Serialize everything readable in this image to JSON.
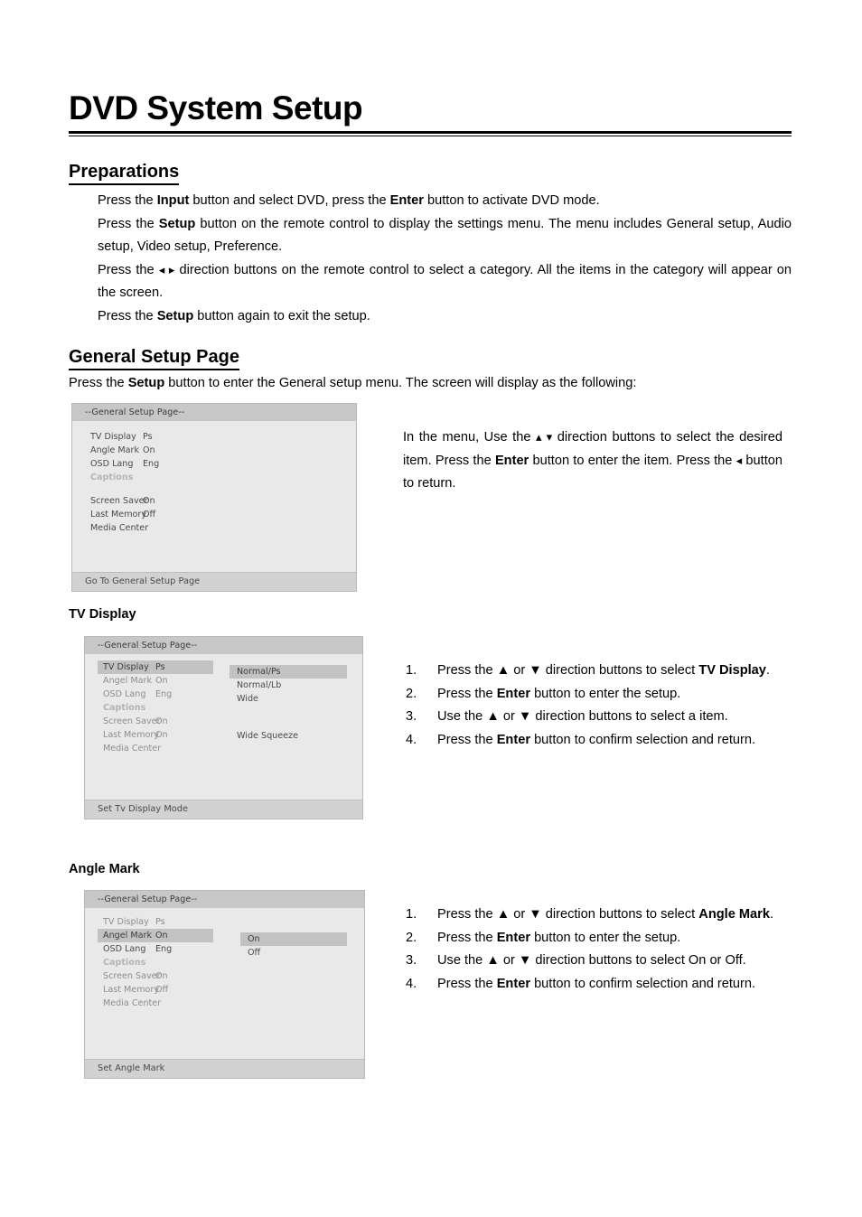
{
  "document": {
    "title": "DVD System Setup"
  },
  "preparations": {
    "heading": "Preparations",
    "lines": [
      " Press the Input button and select DVD, press the Enter button to activate DVD mode.",
      "Press the Setup button on the remote control to display the settings menu. The menu includes General setup, Audio setup, Video setup, Preference.",
      "Press the ◂ ▸ direction buttons on the remote control to select a category. All the items in the category will appear on the screen.",
      "Press the Setup button again to exit the setup."
    ],
    "line1_prefix": " Press the ",
    "line1_b1": "Input",
    "line1_mid": " button and select DVD, press the ",
    "line1_b2": "Enter",
    "line1_suffix": " button to activate DVD mode.",
    "line2_prefix": "Press the ",
    "line2_b1": "Setup",
    "line2_suffix": " button on the remote control to display the settings menu. The menu includes General setup, Audio setup, Video setup, Preference.",
    "line3_prefix": "Press the ",
    "line3_arrows": "◂ ▸",
    "line3_suffix": " direction buttons on the remote control to select a category. All the items in the category will appear on the screen.",
    "line4_prefix": "Press the ",
    "line4_b1": "Setup",
    "line4_suffix": " button again to exit the setup."
  },
  "general_setup": {
    "heading": "General Setup Page",
    "intro_prefix": "Press the ",
    "intro_bold": "Setup",
    "intro_suffix": " button to enter the General setup menu. The screen will display as the following:",
    "side_note_1": "In the menu, Use the ",
    "side_note_arrows": "▴ ▾",
    "side_note_2": " direction buttons to select the desired item. Press the ",
    "side_note_bold": "Enter",
    "side_note_3": " button to enter the item. Press the ",
    "side_note_arrow_left": "◂",
    "side_note_4": " button to return."
  },
  "osd_general": {
    "title": "--General Setup Page--",
    "footer": "Go To General Setup Page",
    "rows": [
      {
        "label": "TV Display",
        "value": "Ps"
      },
      {
        "label": "Angle Mark",
        "value": "On"
      },
      {
        "label": "OSD Lang",
        "value": "Eng"
      },
      {
        "label": "Captions",
        "value": ""
      },
      {
        "label": "Screen Saver",
        "value": "On"
      },
      {
        "label": "Last Memory",
        "value": "Off"
      },
      {
        "label": "Media Center",
        "value": ""
      }
    ]
  },
  "tv_display": {
    "sub_heading": "TV Display",
    "osd": {
      "title": "--General Setup Page--",
      "footer": "Set Tv Display Mode",
      "rows": [
        {
          "label": "TV Display",
          "value": "Ps"
        },
        {
          "label": "Angel Mark",
          "value": "On"
        },
        {
          "label": "OSD Lang",
          "value": "Eng"
        },
        {
          "label": "Captions",
          "value": ""
        },
        {
          "label": "Screen Saver",
          "value": "On"
        },
        {
          "label": "Last Memory",
          "value": "On"
        },
        {
          "label": "Media Center",
          "value": ""
        }
      ],
      "selected_row": "TV Display",
      "options": [
        "Normal/Ps",
        "Normal/Lb",
        "Wide",
        "Wide Squeeze"
      ],
      "selected_option": "Normal/Ps"
    },
    "steps": [
      {
        "num": "1.",
        "prefix": "Press the ▲ or ▼ direction buttons to select ",
        "bold": "TV Display",
        "suffix": "."
      },
      {
        "num": "2.",
        "prefix": "Press the ",
        "bold": "Enter",
        "suffix": " button to enter the setup."
      },
      {
        "num": "3.",
        "prefix": "Use the ▲ or ▼ direction buttons to select a item.",
        "bold": "",
        "suffix": ""
      },
      {
        "num": "4.",
        "prefix": "Press the ",
        "bold": "Enter",
        "suffix": " button to confirm selection and return."
      }
    ]
  },
  "angle_mark": {
    "sub_heading": "Angle Mark",
    "osd": {
      "title": "--General Setup Page--",
      "footer": "Set Angle Mark",
      "rows": [
        {
          "label": "TV Display",
          "value": "Ps"
        },
        {
          "label": "Angel Mark",
          "value": "On"
        },
        {
          "label": "OSD Lang",
          "value": "Eng"
        },
        {
          "label": "Captions",
          "value": ""
        },
        {
          "label": "Screen Saver",
          "value": "On"
        },
        {
          "label": "Last Memory",
          "value": "Off"
        },
        {
          "label": "Media Center",
          "value": ""
        }
      ],
      "selected_row": "Angel Mark",
      "options": [
        "On",
        "Off"
      ],
      "selected_option": "On"
    },
    "steps": [
      {
        "num": "1.",
        "prefix": "Press the ▲ or ▼ direction buttons to select ",
        "bold": "Angle Mark",
        "suffix": "."
      },
      {
        "num": "2.",
        "prefix": "Press the ",
        "bold": "Enter",
        "suffix": " button to enter the setup."
      },
      {
        "num": "3.",
        "prefix": "Use the ▲ or ▼ direction buttons to select On or Off.",
        "bold": "",
        "suffix": ""
      },
      {
        "num": "4.",
        "prefix": "Press the ",
        "bold": "Enter",
        "suffix": " button to confirm selection and return."
      }
    ]
  },
  "colors": {
    "osd_background": "#e9e9e9",
    "osd_titlebar": "#c7c7c7",
    "osd_highlight": "#c2c2c2",
    "osd_footer": "#d2d2d2",
    "text": "#000000"
  }
}
